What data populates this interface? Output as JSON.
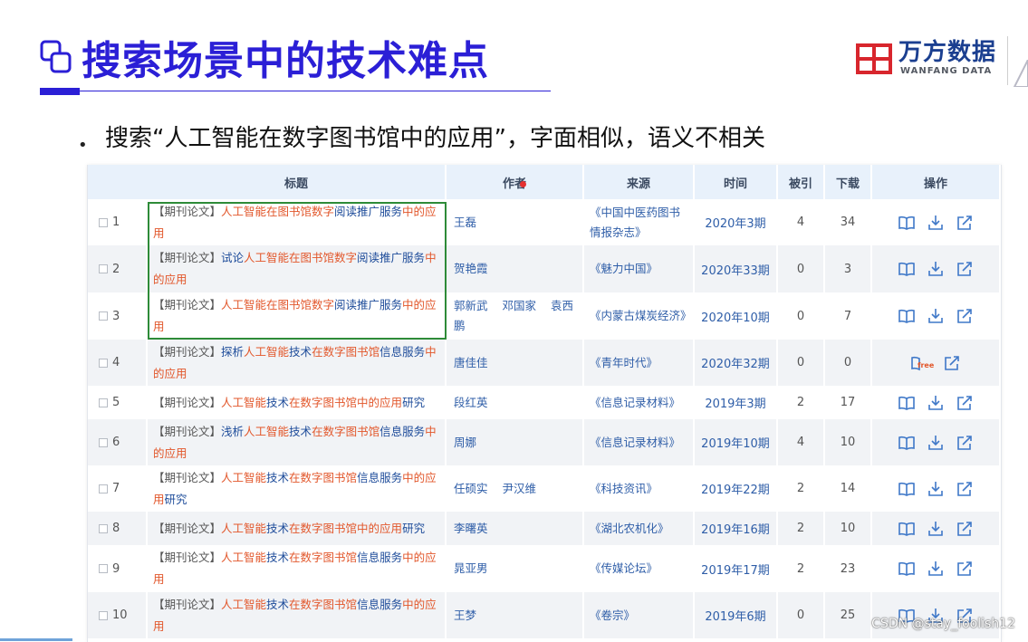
{
  "slide": {
    "title": "搜索场景中的技术难点",
    "bullet": "搜索“人工智能在数字图书馆中的应用”，字面相似，语义不相关"
  },
  "logo": {
    "cn": "万方数据",
    "en": "WANFANG DATA"
  },
  "colors": {
    "title": "#2b1fd6",
    "keyword": "#e2572b",
    "link": "#1e4c9a",
    "highlight_box": "#2e8b38",
    "header_bg": "#e8f1fb"
  },
  "table": {
    "headers": [
      "标题",
      "作者",
      "来源",
      "时间",
      "被引",
      "下载",
      "操作"
    ],
    "rows": [
      {
        "num": "1",
        "title_parts": [
          [
            "【期刊论文】",
            "b"
          ],
          [
            "人工智能在图书馆数字",
            "r"
          ],
          [
            "阅读推广服务",
            "l"
          ],
          [
            "中的应用",
            "r"
          ]
        ],
        "authors": [
          "王磊"
        ],
        "source": "《中国中医药图书情报杂志》",
        "time": "2020年3期",
        "cited": "4",
        "downloads": "34",
        "ops": [
          "read-icon",
          "download-icon",
          "external-link-icon"
        ]
      },
      {
        "num": "2",
        "title_parts": [
          [
            "【期刊论文】",
            "b"
          ],
          [
            "试论",
            "l"
          ],
          [
            "人工智能在图书馆数字",
            "r"
          ],
          [
            "阅读推广服务",
            "l"
          ],
          [
            "中的应用",
            "r"
          ]
        ],
        "authors": [
          "贺艳霞"
        ],
        "source": "《魅力中国》",
        "time": "2020年33期",
        "cited": "0",
        "downloads": "3",
        "ops": [
          "read-icon",
          "download-icon",
          "external-link-icon"
        ]
      },
      {
        "num": "3",
        "title_parts": [
          [
            "【期刊论文】",
            "b"
          ],
          [
            "人工智能在图书馆数字",
            "r"
          ],
          [
            "阅读推广服务",
            "l"
          ],
          [
            "中的应用",
            "r"
          ]
        ],
        "authors": [
          "郭新武",
          "邓国家",
          "袁西鹏"
        ],
        "source": "《内蒙古煤炭经济》",
        "time": "2020年10期",
        "cited": "0",
        "downloads": "7",
        "ops": [
          "read-icon",
          "download-icon",
          "external-link-icon"
        ]
      },
      {
        "num": "4",
        "title_parts": [
          [
            "【期刊论文】",
            "b"
          ],
          [
            "探析",
            "l"
          ],
          [
            "人工智能",
            "r"
          ],
          [
            "技术",
            "l"
          ],
          [
            "在数字图书馆",
            "r"
          ],
          [
            "信息服务",
            "l"
          ],
          [
            "中的应用",
            "r"
          ]
        ],
        "authors": [
          "唐佳佳"
        ],
        "source": "《青年时代》",
        "time": "2020年32期",
        "cited": "0",
        "downloads": "0",
        "ops": [
          "free-read-icon",
          "external-link-icon"
        ],
        "free_badge": "free"
      },
      {
        "num": "5",
        "title_parts": [
          [
            "【期刊论文】",
            "b"
          ],
          [
            "人工智能",
            "r"
          ],
          [
            "技术",
            "l"
          ],
          [
            "在数字图书馆中的应用",
            "r"
          ],
          [
            "研究",
            "l"
          ]
        ],
        "authors": [
          "段红英"
        ],
        "source": "《信息记录材料》",
        "time": "2019年3期",
        "cited": "2",
        "downloads": "17",
        "ops": [
          "read-icon",
          "download-icon",
          "external-link-icon"
        ]
      },
      {
        "num": "6",
        "title_parts": [
          [
            "【期刊论文】",
            "b"
          ],
          [
            "浅析",
            "l"
          ],
          [
            "人工智能",
            "r"
          ],
          [
            "技术",
            "l"
          ],
          [
            "在数字图书馆",
            "r"
          ],
          [
            "信息服务",
            "l"
          ],
          [
            "中的应用",
            "r"
          ]
        ],
        "authors": [
          "周娜"
        ],
        "source": "《信息记录材料》",
        "time": "2019年10期",
        "cited": "4",
        "downloads": "10",
        "ops": [
          "read-icon",
          "download-icon",
          "external-link-icon"
        ]
      },
      {
        "num": "7",
        "title_parts": [
          [
            "【期刊论文】",
            "b"
          ],
          [
            "人工智能",
            "r"
          ],
          [
            "技术",
            "l"
          ],
          [
            "在数字图书馆",
            "r"
          ],
          [
            "信息服务",
            "l"
          ],
          [
            "中的应用",
            "r"
          ],
          [
            "研究",
            "l"
          ]
        ],
        "authors": [
          "任硕实",
          "尹汉维"
        ],
        "source": "《科技资讯》",
        "time": "2019年22期",
        "cited": "2",
        "downloads": "14",
        "ops": [
          "read-icon",
          "download-icon",
          "external-link-icon"
        ]
      },
      {
        "num": "8",
        "title_parts": [
          [
            "【期刊论文】",
            "b"
          ],
          [
            "人工智能",
            "r"
          ],
          [
            "技术",
            "l"
          ],
          [
            "在数字图书馆中的应用",
            "r"
          ],
          [
            "研究",
            "l"
          ]
        ],
        "authors": [
          "李曙英"
        ],
        "source": "《湖北农机化》",
        "time": "2019年16期",
        "cited": "2",
        "downloads": "10",
        "ops": [
          "read-icon",
          "download-icon",
          "external-link-icon"
        ]
      },
      {
        "num": "9",
        "title_parts": [
          [
            "【期刊论文】",
            "b"
          ],
          [
            "人工智能",
            "r"
          ],
          [
            "技术",
            "l"
          ],
          [
            "在数字图书馆",
            "r"
          ],
          [
            "信息服务",
            "l"
          ],
          [
            "中的应用",
            "r"
          ]
        ],
        "authors": [
          "晁亚男"
        ],
        "source": "《传媒论坛》",
        "time": "2019年17期",
        "cited": "2",
        "downloads": "23",
        "ops": [
          "read-icon",
          "download-icon",
          "external-link-icon"
        ]
      },
      {
        "num": "10",
        "title_parts": [
          [
            "【期刊论文】",
            "b"
          ],
          [
            "人工智能",
            "r"
          ],
          [
            "技术",
            "l"
          ],
          [
            "在数字图书馆",
            "r"
          ],
          [
            "信息服务",
            "l"
          ],
          [
            "中的应用",
            "r"
          ]
        ],
        "authors": [
          "王梦"
        ],
        "source": "《卷宗》",
        "time": "2019年6期",
        "cited": "0",
        "downloads": "25",
        "ops": [
          "read-icon",
          "download-icon",
          "external-link-icon"
        ]
      }
    ]
  },
  "watermark": "CSDN @stay_foolish12"
}
